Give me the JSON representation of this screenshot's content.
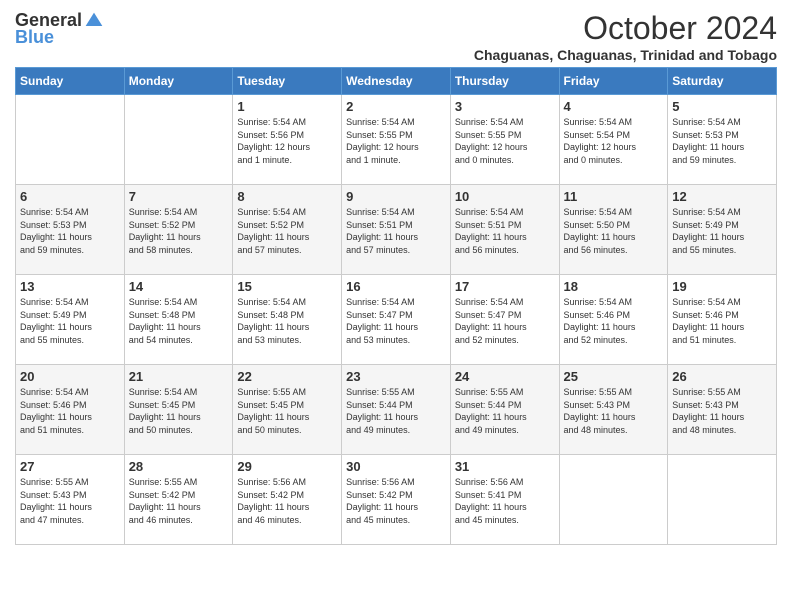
{
  "header": {
    "logo_general": "General",
    "logo_blue": "Blue",
    "month_title": "October 2024",
    "location": "Chaguanas, Chaguanas, Trinidad and Tobago"
  },
  "weekdays": [
    "Sunday",
    "Monday",
    "Tuesday",
    "Wednesday",
    "Thursday",
    "Friday",
    "Saturday"
  ],
  "weeks": [
    [
      {
        "day": "",
        "info": ""
      },
      {
        "day": "",
        "info": ""
      },
      {
        "day": "1",
        "info": "Sunrise: 5:54 AM\nSunset: 5:56 PM\nDaylight: 12 hours\nand 1 minute."
      },
      {
        "day": "2",
        "info": "Sunrise: 5:54 AM\nSunset: 5:55 PM\nDaylight: 12 hours\nand 1 minute."
      },
      {
        "day": "3",
        "info": "Sunrise: 5:54 AM\nSunset: 5:55 PM\nDaylight: 12 hours\nand 0 minutes."
      },
      {
        "day": "4",
        "info": "Sunrise: 5:54 AM\nSunset: 5:54 PM\nDaylight: 12 hours\nand 0 minutes."
      },
      {
        "day": "5",
        "info": "Sunrise: 5:54 AM\nSunset: 5:53 PM\nDaylight: 11 hours\nand 59 minutes."
      }
    ],
    [
      {
        "day": "6",
        "info": "Sunrise: 5:54 AM\nSunset: 5:53 PM\nDaylight: 11 hours\nand 59 minutes."
      },
      {
        "day": "7",
        "info": "Sunrise: 5:54 AM\nSunset: 5:52 PM\nDaylight: 11 hours\nand 58 minutes."
      },
      {
        "day": "8",
        "info": "Sunrise: 5:54 AM\nSunset: 5:52 PM\nDaylight: 11 hours\nand 57 minutes."
      },
      {
        "day": "9",
        "info": "Sunrise: 5:54 AM\nSunset: 5:51 PM\nDaylight: 11 hours\nand 57 minutes."
      },
      {
        "day": "10",
        "info": "Sunrise: 5:54 AM\nSunset: 5:51 PM\nDaylight: 11 hours\nand 56 minutes."
      },
      {
        "day": "11",
        "info": "Sunrise: 5:54 AM\nSunset: 5:50 PM\nDaylight: 11 hours\nand 56 minutes."
      },
      {
        "day": "12",
        "info": "Sunrise: 5:54 AM\nSunset: 5:49 PM\nDaylight: 11 hours\nand 55 minutes."
      }
    ],
    [
      {
        "day": "13",
        "info": "Sunrise: 5:54 AM\nSunset: 5:49 PM\nDaylight: 11 hours\nand 55 minutes."
      },
      {
        "day": "14",
        "info": "Sunrise: 5:54 AM\nSunset: 5:48 PM\nDaylight: 11 hours\nand 54 minutes."
      },
      {
        "day": "15",
        "info": "Sunrise: 5:54 AM\nSunset: 5:48 PM\nDaylight: 11 hours\nand 53 minutes."
      },
      {
        "day": "16",
        "info": "Sunrise: 5:54 AM\nSunset: 5:47 PM\nDaylight: 11 hours\nand 53 minutes."
      },
      {
        "day": "17",
        "info": "Sunrise: 5:54 AM\nSunset: 5:47 PM\nDaylight: 11 hours\nand 52 minutes."
      },
      {
        "day": "18",
        "info": "Sunrise: 5:54 AM\nSunset: 5:46 PM\nDaylight: 11 hours\nand 52 minutes."
      },
      {
        "day": "19",
        "info": "Sunrise: 5:54 AM\nSunset: 5:46 PM\nDaylight: 11 hours\nand 51 minutes."
      }
    ],
    [
      {
        "day": "20",
        "info": "Sunrise: 5:54 AM\nSunset: 5:46 PM\nDaylight: 11 hours\nand 51 minutes."
      },
      {
        "day": "21",
        "info": "Sunrise: 5:54 AM\nSunset: 5:45 PM\nDaylight: 11 hours\nand 50 minutes."
      },
      {
        "day": "22",
        "info": "Sunrise: 5:55 AM\nSunset: 5:45 PM\nDaylight: 11 hours\nand 50 minutes."
      },
      {
        "day": "23",
        "info": "Sunrise: 5:55 AM\nSunset: 5:44 PM\nDaylight: 11 hours\nand 49 minutes."
      },
      {
        "day": "24",
        "info": "Sunrise: 5:55 AM\nSunset: 5:44 PM\nDaylight: 11 hours\nand 49 minutes."
      },
      {
        "day": "25",
        "info": "Sunrise: 5:55 AM\nSunset: 5:43 PM\nDaylight: 11 hours\nand 48 minutes."
      },
      {
        "day": "26",
        "info": "Sunrise: 5:55 AM\nSunset: 5:43 PM\nDaylight: 11 hours\nand 48 minutes."
      }
    ],
    [
      {
        "day": "27",
        "info": "Sunrise: 5:55 AM\nSunset: 5:43 PM\nDaylight: 11 hours\nand 47 minutes."
      },
      {
        "day": "28",
        "info": "Sunrise: 5:55 AM\nSunset: 5:42 PM\nDaylight: 11 hours\nand 46 minutes."
      },
      {
        "day": "29",
        "info": "Sunrise: 5:56 AM\nSunset: 5:42 PM\nDaylight: 11 hours\nand 46 minutes."
      },
      {
        "day": "30",
        "info": "Sunrise: 5:56 AM\nSunset: 5:42 PM\nDaylight: 11 hours\nand 45 minutes."
      },
      {
        "day": "31",
        "info": "Sunrise: 5:56 AM\nSunset: 5:41 PM\nDaylight: 11 hours\nand 45 minutes."
      },
      {
        "day": "",
        "info": ""
      },
      {
        "day": "",
        "info": ""
      }
    ]
  ]
}
